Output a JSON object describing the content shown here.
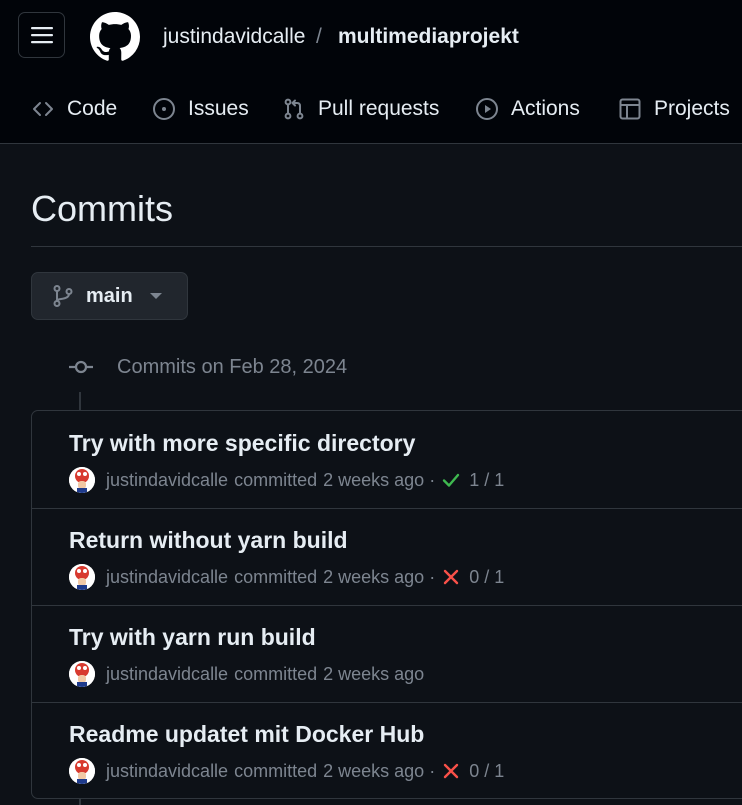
{
  "header": {
    "owner": "justindavidcalle",
    "separator": "/",
    "repo": "multimediaprojekt"
  },
  "nav": {
    "tabs": [
      {
        "label": "Code",
        "icon": "code-icon"
      },
      {
        "label": "Issues",
        "icon": "issue-opened-icon"
      },
      {
        "label": "Pull requests",
        "icon": "git-pull-request-icon"
      },
      {
        "label": "Actions",
        "icon": "play-icon"
      },
      {
        "label": "Projects",
        "icon": "table-icon"
      }
    ]
  },
  "page": {
    "title": "Commits",
    "branch": "main"
  },
  "commits_group": {
    "date_label": "Commits on Feb 28, 2024",
    "commits": [
      {
        "message": "Try with more specific directory",
        "author": "justindavidcalle",
        "action": "committed",
        "time": "2 weeks ago",
        "separator": "·",
        "status": "success",
        "checks": "1 / 1"
      },
      {
        "message": "Return without yarn build",
        "author": "justindavidcalle",
        "action": "committed",
        "time": "2 weeks ago",
        "separator": "·",
        "status": "failure",
        "checks": "0 / 1"
      },
      {
        "message": "Try with yarn run build",
        "author": "justindavidcalle",
        "action": "committed",
        "time": "2 weeks ago",
        "separator": "",
        "status": "none",
        "checks": ""
      },
      {
        "message": "Readme updatet mit Docker Hub",
        "author": "justindavidcalle",
        "action": "committed",
        "time": "2 weeks ago",
        "separator": "·",
        "status": "failure",
        "checks": "0 / 1"
      }
    ]
  },
  "colors": {
    "background": "#0d1117",
    "header_bg": "#010409",
    "border": "#30363d",
    "text": "#e6edf3",
    "muted": "#7d8590",
    "success": "#3fb950",
    "failure": "#f85149"
  }
}
